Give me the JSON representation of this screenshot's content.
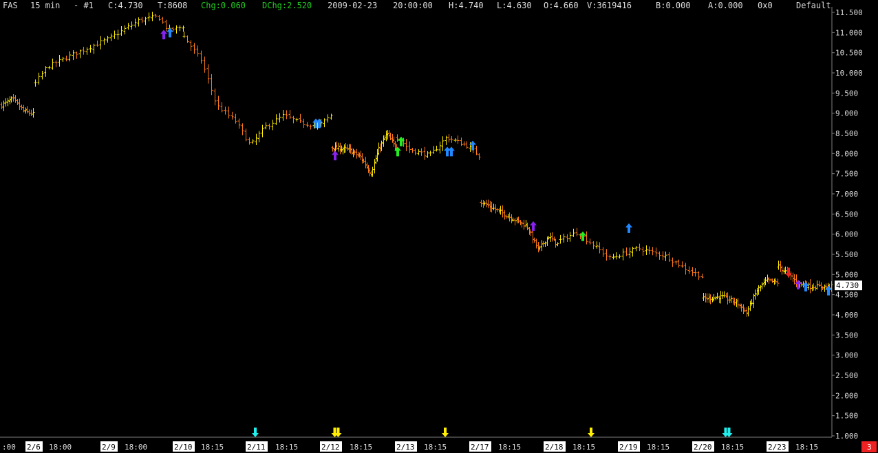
{
  "header": {
    "symbol": "FAS",
    "interval": "15 min",
    "chart_index": "- #1",
    "close": "C:4.730",
    "trades": "T:8608",
    "change": "Chg:0.060",
    "day_change": "DChg:2.520",
    "date": "2009-02-23",
    "time": "20:00:00",
    "high": "H:4.740",
    "low": "L:4.630",
    "open": "O:4.660",
    "volume": "V:3619416",
    "bid": "B:0.000",
    "ask": "A:0.000",
    "size": "0x0",
    "layout": "Default"
  },
  "last_price_label": "4.730",
  "corner_badge": "3",
  "x_axis_labels": [
    {
      "text": ":00",
      "boxed": false
    },
    {
      "text": "2/6",
      "boxed": true
    },
    {
      "text": "18:00",
      "boxed": false
    },
    {
      "text": "2/9",
      "boxed": true
    },
    {
      "text": "18:00",
      "boxed": false
    },
    {
      "text": "2/10",
      "boxed": true
    },
    {
      "text": "18:15",
      "boxed": false
    },
    {
      "text": "2/11",
      "boxed": true
    },
    {
      "text": "18:15",
      "boxed": false
    },
    {
      "text": "2/12",
      "boxed": true
    },
    {
      "text": "18:15",
      "boxed": false
    },
    {
      "text": "2/13",
      "boxed": true
    },
    {
      "text": "18:15",
      "boxed": false
    },
    {
      "text": "2/17",
      "boxed": true
    },
    {
      "text": "18:15",
      "boxed": false
    },
    {
      "text": "2/18",
      "boxed": true
    },
    {
      "text": "18:15",
      "boxed": false
    },
    {
      "text": "2/19",
      "boxed": true
    },
    {
      "text": "18:15",
      "boxed": false
    },
    {
      "text": "2/20",
      "boxed": true
    },
    {
      "text": "18:15",
      "boxed": false
    },
    {
      "text": "2/23",
      "boxed": true
    },
    {
      "text": "18:15",
      "boxed": false
    }
  ],
  "colors": {
    "background": "#000000",
    "header_text": "#dddddd",
    "header_green": "#22cc22",
    "bar_up": "#ffee00",
    "bar_down": "#ff7a1a",
    "axis_line": "#808080",
    "arrow_blue": "#2288ff",
    "arrow_purple": "#8822ee",
    "arrow_green": "#22ee22",
    "arrow_red": "#ee2222",
    "arrow_cyan": "#22eeee",
    "arrow_yellow": "#ffee00",
    "badge_bg": "#ee2222"
  },
  "chart_data": {
    "type": "ohlc",
    "title": "",
    "xlabel": "",
    "ylabel": "",
    "ylim": [
      1.0,
      11.5
    ],
    "y_ticks": [
      "11.500",
      "11.000",
      "10.500",
      "10.000",
      "9.500",
      "9.000",
      "8.500",
      "8.000",
      "7.500",
      "7.000",
      "6.500",
      "6.000",
      "5.500",
      "5.000",
      "4.500",
      "4.000",
      "3.500",
      "3.000",
      "2.500",
      "2.000",
      "1.500",
      "1.000"
    ],
    "grid": false,
    "sessions": [
      {
        "label": "2/6",
        "bars": 17,
        "path": [
          [
            0,
            9.2
          ],
          [
            0.35,
            9.35
          ],
          [
            0.7,
            9.05
          ],
          [
            1,
            8.98
          ]
        ]
      },
      {
        "label": "2/9",
        "bars": 44,
        "path": [
          [
            0,
            9.75
          ],
          [
            0.08,
            10.15
          ],
          [
            0.25,
            10.45
          ],
          [
            0.5,
            10.85
          ],
          [
            0.7,
            11.3
          ],
          [
            0.83,
            11.4
          ],
          [
            0.9,
            11.05
          ],
          [
            1,
            11.15
          ]
        ]
      },
      {
        "label": "2/10",
        "bars": 44,
        "path": [
          [
            0,
            10.9
          ],
          [
            0.12,
            10.3
          ],
          [
            0.22,
            9.2
          ],
          [
            0.35,
            8.8
          ],
          [
            0.45,
            8.2
          ],
          [
            0.55,
            8.65
          ],
          [
            0.68,
            8.95
          ],
          [
            0.8,
            8.75
          ],
          [
            0.92,
            8.7
          ],
          [
            1,
            8.95
          ]
        ]
      },
      {
        "label": "2/12",
        "bars": 44,
        "path": [
          [
            0,
            8.15
          ],
          [
            0.25,
            8.1
          ],
          [
            0.45,
            7.9
          ],
          [
            0.6,
            7.5
          ],
          [
            0.72,
            8.1
          ],
          [
            0.85,
            8.5
          ],
          [
            1,
            8.1
          ]
        ]
      },
      {
        "label": "2/13",
        "bars": 28,
        "path": [
          [
            0,
            8.4
          ],
          [
            0.15,
            8.1
          ],
          [
            0.4,
            7.95
          ],
          [
            0.6,
            8.4
          ],
          [
            0.85,
            8.2
          ],
          [
            1,
            7.95
          ]
        ]
      },
      {
        "label": "2/17",
        "bars": 44,
        "path": [
          [
            0,
            6.8
          ],
          [
            0.15,
            6.65
          ],
          [
            0.4,
            6.4
          ],
          [
            0.6,
            6.2
          ],
          [
            0.75,
            5.6
          ],
          [
            0.88,
            5.95
          ],
          [
            1,
            5.75
          ]
        ]
      },
      {
        "label": "2/19",
        "bars": 44,
        "path": [
          [
            0,
            5.85
          ],
          [
            0.12,
            6.05
          ],
          [
            0.35,
            5.4
          ],
          [
            0.55,
            5.65
          ],
          [
            0.75,
            5.45
          ],
          [
            0.88,
            5.15
          ],
          [
            1,
            4.95
          ]
        ]
      },
      {
        "label": "2/20",
        "bars": 44,
        "path": [
          [
            0,
            4.4
          ],
          [
            0.25,
            4.45
          ],
          [
            0.45,
            4.3
          ],
          [
            0.58,
            4.05
          ],
          [
            0.72,
            4.6
          ],
          [
            0.85,
            4.85
          ],
          [
            1,
            4.8
          ]
        ]
      },
      {
        "label": "2/23",
        "bars": 31,
        "path": [
          [
            0,
            5.2
          ],
          [
            0.15,
            5.05
          ],
          [
            0.35,
            4.8
          ],
          [
            0.6,
            4.7
          ],
          [
            1,
            4.7
          ]
        ]
      }
    ],
    "signals": [
      {
        "color": "purple",
        "dir": "up",
        "price": 10.95
      },
      {
        "color": "blue",
        "dir": "up",
        "price": 11.0
      },
      {
        "color": "blue",
        "dir": "up",
        "price": 8.75
      },
      {
        "color": "blue",
        "dir": "up",
        "price": 8.75
      },
      {
        "color": "purple",
        "dir": "up",
        "price": 7.95
      },
      {
        "color": "green",
        "dir": "up",
        "price": 8.05
      },
      {
        "color": "green",
        "dir": "up",
        "price": 8.3
      },
      {
        "color": "blue",
        "dir": "up",
        "price": 8.05
      },
      {
        "color": "blue",
        "dir": "up",
        "price": 8.05
      },
      {
        "color": "blue",
        "dir": "up",
        "price": 8.2
      },
      {
        "color": "purple",
        "dir": "up",
        "price": 6.2
      },
      {
        "color": "green",
        "dir": "up",
        "price": 5.95
      },
      {
        "color": "blue",
        "dir": "up",
        "price": 6.15
      },
      {
        "color": "red",
        "dir": "down",
        "price": 5.05
      },
      {
        "color": "purple",
        "dir": "up",
        "price": 4.75
      },
      {
        "color": "blue",
        "dir": "up",
        "price": 4.7
      },
      {
        "color": "blue",
        "dir": "up",
        "price": 4.6
      }
    ],
    "bottom_markers": [
      {
        "color": "cyan",
        "count": 1
      },
      {
        "color": "yellow",
        "count": 2
      },
      {
        "color": "yellow",
        "count": 1
      },
      {
        "color": "yellow",
        "count": 1
      },
      {
        "color": "cyan",
        "count": 2
      }
    ]
  }
}
